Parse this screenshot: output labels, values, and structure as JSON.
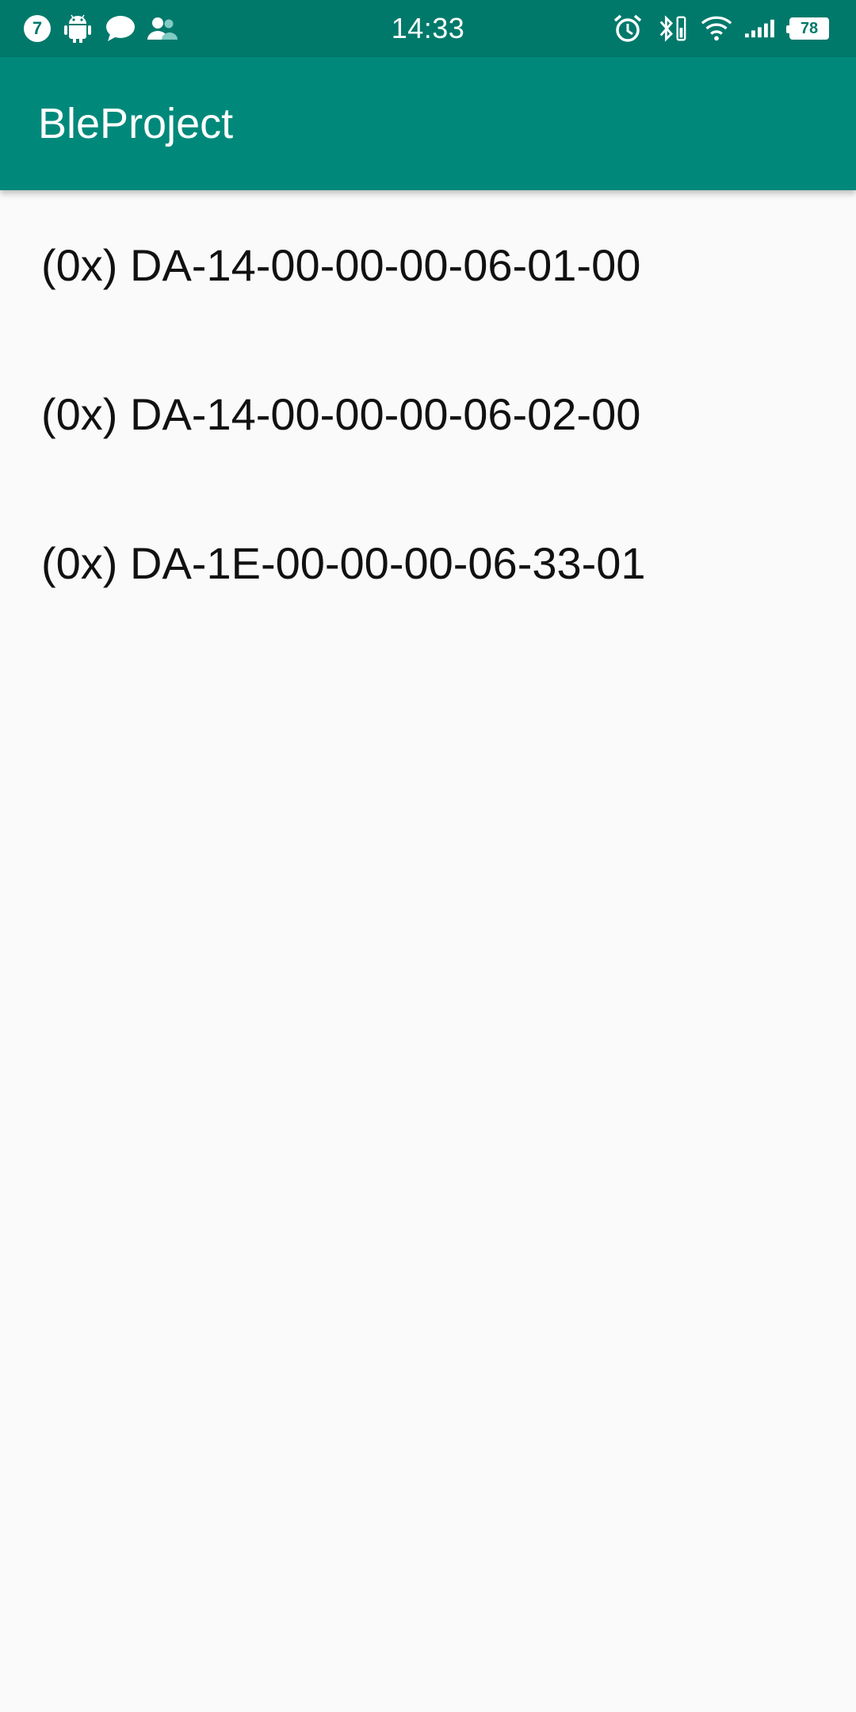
{
  "status_bar": {
    "notification_count": "7",
    "time": "14:33",
    "battery_level": "78",
    "left_icons": [
      "android-icon",
      "chat-icon",
      "contacts-icon"
    ],
    "right_icons": [
      "alarm-icon",
      "bluetooth-icon",
      "wifi-icon",
      "signal-icon"
    ]
  },
  "app_bar": {
    "title": "BleProject"
  },
  "devices": [
    {
      "label": "(0x) DA-14-00-00-00-06-01-00"
    },
    {
      "label": "(0x) DA-14-00-00-00-06-02-00"
    },
    {
      "label": "(0x) DA-1E-00-00-00-06-33-01"
    }
  ],
  "colors": {
    "status_bar": "#00796b",
    "app_bar": "#00897b",
    "background": "#fafafa",
    "text": "#111111"
  }
}
